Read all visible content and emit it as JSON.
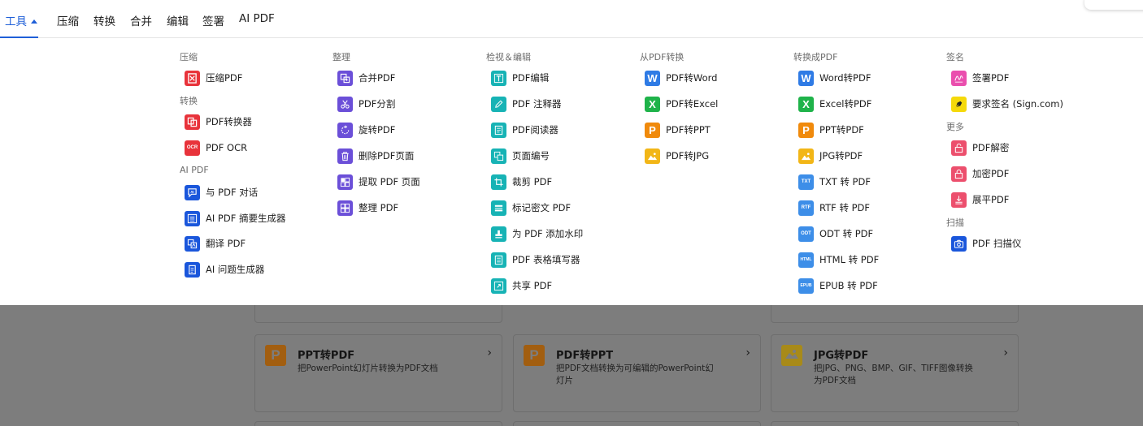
{
  "nav": {
    "items": [
      {
        "label": "工具",
        "active": true
      },
      {
        "label": "压缩"
      },
      {
        "label": "转换"
      },
      {
        "label": "合并"
      },
      {
        "label": "编辑"
      },
      {
        "label": "签署"
      },
      {
        "label": "AI PDF"
      }
    ]
  },
  "menu": {
    "col1": {
      "groups": [
        {
          "title": "压缩",
          "items": [
            {
              "label": "压缩PDF",
              "icon": "compress-icon",
              "color": "#e8333b"
            }
          ]
        },
        {
          "title": "转换",
          "items": [
            {
              "label": "PDF转换器",
              "icon": "convert-icon",
              "color": "#e8333b"
            },
            {
              "label": "PDF OCR",
              "icon": "ocr-icon",
              "badge": "OCR",
              "color": "#e8333b"
            }
          ]
        },
        {
          "title": "AI PDF",
          "items": [
            {
              "label": "与 PDF 对话",
              "icon": "ai-chat-icon",
              "badge": "AI",
              "color": "#1a56db"
            },
            {
              "label": "AI PDF 摘要生成器",
              "icon": "summary-list-icon",
              "color": "#1a56db"
            },
            {
              "label": "翻译 PDF",
              "icon": "translate-icon",
              "color": "#1a56db"
            },
            {
              "label": "AI 问题生成器",
              "icon": "question-doc-icon",
              "color": "#1a56db"
            }
          ]
        }
      ]
    },
    "col2": {
      "groups": [
        {
          "title": "整理",
          "items": [
            {
              "label": "合并PDF",
              "icon": "merge-icon",
              "color": "#6b4fd8"
            },
            {
              "label": "PDF分割",
              "icon": "scissors-icon",
              "color": "#6b4fd8"
            },
            {
              "label": "旋转PDF",
              "icon": "rotate-icon",
              "color": "#6b4fd8"
            },
            {
              "label": "删除PDF页面",
              "icon": "trash-icon",
              "color": "#6b4fd8"
            },
            {
              "label": "提取 PDF 页面",
              "icon": "extract-icon",
              "color": "#6b4fd8"
            },
            {
              "label": "整理 PDF",
              "icon": "grid-icon",
              "color": "#6b4fd8"
            }
          ]
        }
      ]
    },
    "col3": {
      "groups": [
        {
          "title": "检视＆编辑",
          "items": [
            {
              "label": "PDF编辑",
              "icon": "text-edit-icon",
              "color": "#17b3b5"
            },
            {
              "label": "PDF 注释器",
              "icon": "pen-icon",
              "color": "#17b3b5"
            },
            {
              "label": "PDF阅读器",
              "icon": "reader-icon",
              "color": "#17b3b5"
            },
            {
              "label": "页面编号",
              "icon": "page-number-icon",
              "color": "#17b3b5"
            },
            {
              "label": "裁剪 PDF",
              "icon": "crop-icon",
              "color": "#17b3b5"
            },
            {
              "label": "标记密文 PDF",
              "icon": "redact-icon",
              "color": "#17b3b5"
            },
            {
              "label": "为 PDF 添加水印",
              "icon": "stamp-icon",
              "color": "#17b3b5"
            },
            {
              "label": "PDF 表格填写器",
              "icon": "form-icon",
              "color": "#17b3b5"
            },
            {
              "label": "共享 PDF",
              "icon": "share-icon",
              "color": "#17b3b5"
            }
          ]
        }
      ]
    },
    "col4": {
      "groups": [
        {
          "title": "从PDF转换",
          "items": [
            {
              "label": "PDF转Word",
              "icon": "word-icon",
              "badge": "W",
              "color": "#2f7be5"
            },
            {
              "label": "PDF转Excel",
              "icon": "excel-icon",
              "badge": "X",
              "color": "#1fb34a"
            },
            {
              "label": "PDF转PPT",
              "icon": "ppt-icon",
              "badge": "P",
              "color": "#f08a0c"
            },
            {
              "label": "PDF转JPG",
              "icon": "image-icon",
              "color": "#f2b617"
            }
          ]
        }
      ]
    },
    "col5": {
      "groups": [
        {
          "title": "转换成PDF",
          "items": [
            {
              "label": "Word转PDF",
              "icon": "word-icon",
              "badge": "W",
              "color": "#2f7be5"
            },
            {
              "label": "Excel转PDF",
              "icon": "excel-icon",
              "badge": "X",
              "color": "#1fb34a"
            },
            {
              "label": "PPT转PDF",
              "icon": "ppt-icon",
              "badge": "P",
              "color": "#f08a0c"
            },
            {
              "label": "JPG转PDF",
              "icon": "image-icon",
              "color": "#f2b617"
            },
            {
              "label": "TXT 转 PDF",
              "icon": "txt-icon",
              "badge": "TXT",
              "color": "#3d8ee8"
            },
            {
              "label": "RTF 转 PDF",
              "icon": "rtf-icon",
              "badge": "RTF",
              "color": "#3d8ee8"
            },
            {
              "label": "ODT 转 PDF",
              "icon": "odt-icon",
              "badge": "ODT",
              "color": "#3d8ee8"
            },
            {
              "label": "HTML 转 PDF",
              "icon": "html-icon",
              "badge": "HTML",
              "color": "#3d8ee8"
            },
            {
              "label": "EPUB 转 PDF",
              "icon": "epub-icon",
              "badge": "EPUB",
              "color": "#3d8ee8"
            }
          ]
        }
      ]
    },
    "col6": {
      "groups": [
        {
          "title": "签名",
          "items": [
            {
              "label": "签署PDF",
              "icon": "signature-icon",
              "color": "#ea4fae"
            },
            {
              "label": "要求签名 (Sign.com)",
              "icon": "pen-nib-icon",
              "color": "#f5d90a"
            }
          ]
        },
        {
          "title": "更多",
          "items": [
            {
              "label": "PDF解密",
              "icon": "unlock-icon",
              "color": "#ec4f6d"
            },
            {
              "label": "加密PDF",
              "icon": "lock-icon",
              "color": "#ec4f6d"
            },
            {
              "label": "展平PDF",
              "icon": "flatten-icon",
              "color": "#ec4f6d"
            }
          ]
        },
        {
          "title": "扫描",
          "items": [
            {
              "label": "PDF 扫描仪",
              "icon": "camera-icon",
              "color": "#1a56db"
            }
          ]
        }
      ]
    }
  },
  "background_cards": [
    {
      "title": "PPT转PDF",
      "desc": "把PowerPoint幻灯片转换为PDF文档",
      "icon": "ppt-icon",
      "badge": "P"
    },
    {
      "title": "PDF转PPT",
      "desc": "把PDF文档转换为可编辑的PowerPoint幻灯片",
      "icon": "ppt-icon",
      "badge": "P"
    },
    {
      "title": "JPG转PDF",
      "desc": "把JPG、PNG、BMP、GIF、TIFF图像转换为PDF文档",
      "icon": "image-icon"
    }
  ]
}
